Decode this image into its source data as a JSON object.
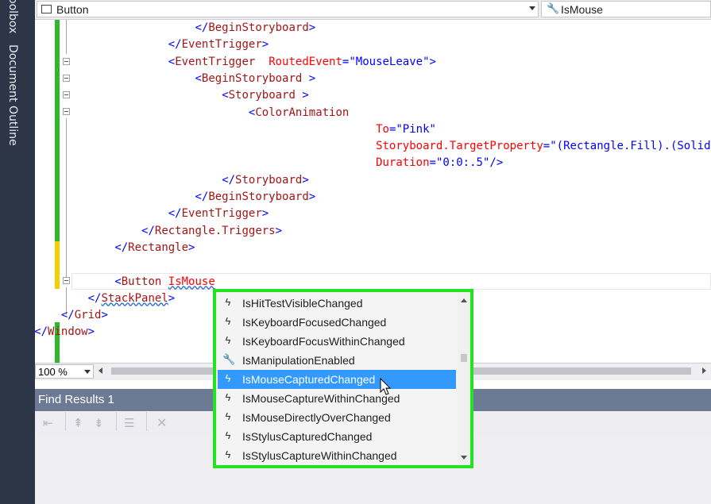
{
  "sidebar": {
    "tabs": [
      "oolbox",
      "Document Outline"
    ]
  },
  "navbar": {
    "type_combo": {
      "icon": "class-icon",
      "value": "Button"
    },
    "member_combo": {
      "icon": "wrench-icon",
      "value": "IsMouse"
    }
  },
  "code_lines": [
    {
      "indent": 36,
      "parts": [
        [
          "b",
          "</"
        ],
        [
          "t",
          "BeginStoryboard"
        ],
        [
          "b",
          ">"
        ]
      ]
    },
    {
      "indent": 32,
      "parts": [
        [
          "b",
          "</"
        ],
        [
          "t",
          "EventTrigger"
        ],
        [
          "b",
          ">"
        ]
      ]
    },
    {
      "indent": 32,
      "parts": [
        [
          "b",
          "<"
        ],
        [
          "t",
          "EventTrigger"
        ],
        [
          "b",
          "  "
        ],
        [
          "a",
          "RoutedEvent"
        ],
        [
          "b",
          "="
        ],
        [
          "v",
          "\"MouseLeave\""
        ],
        [
          "b",
          ">"
        ]
      ]
    },
    {
      "indent": 36,
      "parts": [
        [
          "b",
          "<"
        ],
        [
          "t",
          "BeginStoryboard"
        ],
        [
          "b",
          " >"
        ]
      ]
    },
    {
      "indent": 40,
      "parts": [
        [
          "b",
          "<"
        ],
        [
          "t",
          "Storyboard"
        ],
        [
          "b",
          " >"
        ]
      ]
    },
    {
      "indent": 44,
      "parts": [
        [
          "b",
          "<"
        ],
        [
          "t",
          "ColorAnimation"
        ]
      ]
    },
    {
      "indent": 63,
      "parts": [
        [
          "a",
          "To"
        ],
        [
          "b",
          "="
        ],
        [
          "v",
          "\"Pink\""
        ]
      ]
    },
    {
      "indent": 63,
      "parts": [
        [
          "a",
          "Storyboard.TargetProperty"
        ],
        [
          "b",
          "="
        ],
        [
          "v",
          "\"(Rectangle.Fill).(SolidColorBrush.Color)\""
        ]
      ]
    },
    {
      "indent": 63,
      "parts": [
        [
          "a",
          "Duration"
        ],
        [
          "b",
          "="
        ],
        [
          "v",
          "\"0:0:.5\""
        ],
        [
          "b",
          "/>"
        ]
      ]
    },
    {
      "indent": 40,
      "parts": [
        [
          "b",
          "</"
        ],
        [
          "t",
          "Storyboard"
        ],
        [
          "b",
          ">"
        ]
      ]
    },
    {
      "indent": 36,
      "parts": [
        [
          "b",
          "</"
        ],
        [
          "t",
          "BeginStoryboard"
        ],
        [
          "b",
          ">"
        ]
      ]
    },
    {
      "indent": 32,
      "parts": [
        [
          "b",
          "</"
        ],
        [
          "t",
          "EventTrigger"
        ],
        [
          "b",
          ">"
        ]
      ]
    },
    {
      "indent": 28,
      "parts": [
        [
          "b",
          "</"
        ],
        [
          "t",
          "Rectangle.Triggers"
        ],
        [
          "b",
          ">"
        ]
      ]
    },
    {
      "indent": 24,
      "parts": [
        [
          "b",
          "</"
        ],
        [
          "t",
          "Rectangle"
        ],
        [
          "b",
          ">"
        ]
      ]
    },
    {
      "indent": 24,
      "parts": []
    },
    {
      "indent": 24,
      "parts": [
        [
          "b",
          "<"
        ],
        [
          "t",
          "Button"
        ],
        [
          "b",
          " "
        ],
        [
          "a",
          "IsMouse"
        ]
      ]
    },
    {
      "indent": 20,
      "parts": [
        [
          "b",
          "</"
        ],
        [
          "t",
          "StackPanel"
        ],
        [
          "b",
          ">"
        ]
      ]
    },
    {
      "indent": 16,
      "parts": [
        [
          "b",
          "</"
        ],
        [
          "t",
          "Grid"
        ],
        [
          "b",
          ">"
        ]
      ]
    },
    {
      "indent": 12,
      "parts": [
        [
          "b",
          "</"
        ],
        [
          "t",
          "Window"
        ],
        [
          "b",
          ">"
        ]
      ]
    }
  ],
  "zoom_label": "100 %",
  "find_results": {
    "title": "Find Results 1"
  },
  "intellisense": {
    "items": [
      {
        "icon": "event-icon",
        "label": "IsHitTestVisibleChanged",
        "selected": false
      },
      {
        "icon": "event-icon",
        "label": "IsKeyboardFocusedChanged",
        "selected": false
      },
      {
        "icon": "event-icon",
        "label": "IsKeyboardFocusWithinChanged",
        "selected": false
      },
      {
        "icon": "property-icon",
        "label": "IsManipulationEnabled",
        "selected": false
      },
      {
        "icon": "event-icon",
        "label": "IsMouseCapturedChanged",
        "selected": true
      },
      {
        "icon": "event-icon",
        "label": "IsMouseCaptureWithinChanged",
        "selected": false
      },
      {
        "icon": "event-icon",
        "label": "IsMouseDirectlyOverChanged",
        "selected": false
      },
      {
        "icon": "event-icon",
        "label": "IsStylusCapturedChanged",
        "selected": false
      },
      {
        "icon": "event-icon",
        "label": "IsStylusCaptureWithinChanged",
        "selected": false
      }
    ]
  },
  "colors": {
    "highlight": "#21e321",
    "selection": "#3399ff",
    "sidebar": "#2d3646",
    "panel_header": "#6d7a93"
  }
}
